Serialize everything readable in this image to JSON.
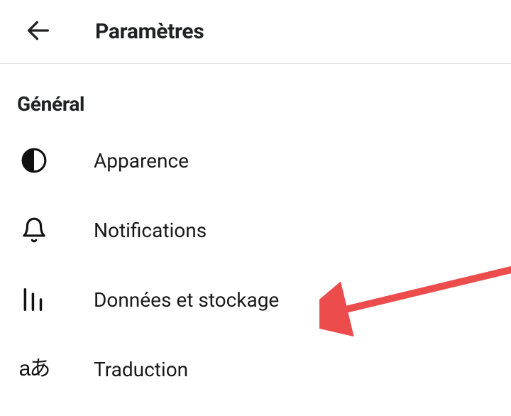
{
  "header": {
    "title": "Paramètres"
  },
  "section": {
    "title": "Général",
    "items": [
      {
        "label": "Apparence"
      },
      {
        "label": "Notifications"
      },
      {
        "label": "Données et stockage"
      },
      {
        "label": "Traduction"
      }
    ]
  },
  "icons": {
    "translation_glyph": "aあ"
  },
  "annotation": {
    "arrow_color": "#ed4c4c"
  }
}
